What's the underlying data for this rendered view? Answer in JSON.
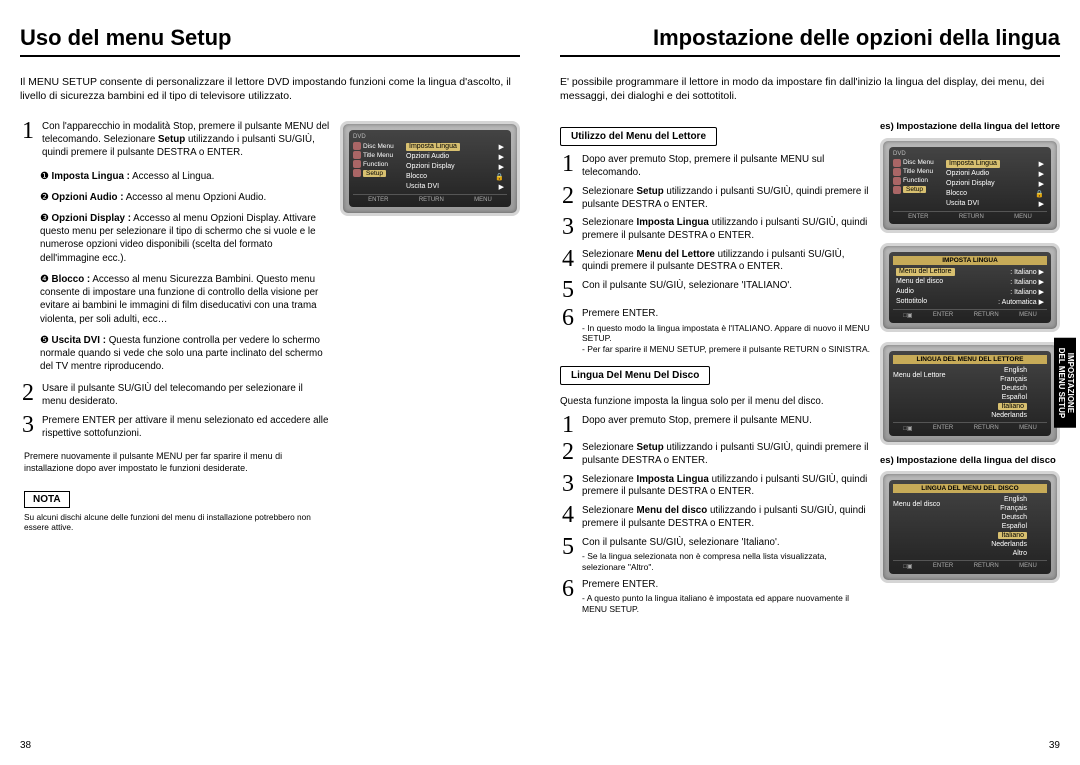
{
  "left": {
    "title": "Uso del menu Setup",
    "intro": "Il MENU SETUP consente di personalizzare il lettore DVD impostando funzioni come la lingua d'ascolto, il livello di sicurezza bambini ed il tipo di televisore utilizzato.",
    "steps": [
      {
        "n": "1",
        "body": "Con l'apparecchio in modalità Stop, premere il pulsante MENU del telecomando. Selezionare <b>Setup</b> utilizzando i pulsanti SU/GIÙ, quindi premere il pulsante DESTRA o ENTER."
      },
      {
        "n": "2",
        "body": "Usare il pulsante SU/GIÙ del telecomando per selezionare il menu desiderato."
      },
      {
        "n": "3",
        "body": "Premere ENTER per attivare il menu selezionato ed accedere alle rispettive sottofunzioni."
      }
    ],
    "bullets": [
      "❶ <b>Imposta Lingua :</b> Accesso al Lingua.",
      "❷ <b>Opzioni Audio :</b> Accesso al menu Opzioni Audio.",
      "❸ <b>Opzioni Display :</b> Accesso al menu Opzioni Display.  Attivare questo menu per selezionare il tipo di schermo che si vuole  e le numerose opzioni video disponibili (scelta del formato dell'immagine ecc.).",
      "❹ <b>Blocco :</b> Accesso al menu Sicurezza Bambini. Questo menu consente di impostare una funzione di controllo della visione per evitare ai bambini le immagini di film diseducativi con una trama violenta, per soli adulti, ecc…",
      "❺ <b>Uscita DVI :</b> Questa funzione controlla per vedere lo schermo normale quando si vede che solo una parte inclinato del schermo del TV mentre riproducendo."
    ],
    "finerule": "Premere nuovamente il pulsante MENU per far sparire il menu di installazione dopo aver impostato le funzioni desiderate.",
    "nota_label": "NOTA",
    "nota_text": "Su alcuni dischi alcune delle funzioni del menu di installazione potrebbero non essere attive.",
    "pagenum": "38",
    "osd1": {
      "dvd": "DVD",
      "menus": [
        "Disc Menu",
        "Title Menu",
        "Function",
        "Setup"
      ],
      "items": [
        {
          "label": "Imposta Lingua",
          "hl": true
        },
        {
          "label": "Opzioni Audio"
        },
        {
          "label": "Opzioni Display"
        },
        {
          "label": "Blocco",
          "icon": "lock"
        },
        {
          "label": "Uscita DVI"
        }
      ],
      "bottom": [
        "ENTER",
        "RETURN",
        "MENU"
      ]
    }
  },
  "right": {
    "title": "Impostazione delle opzioni della lingua",
    "intro": "E' possibile programmare il lettore in modo da impostare fin dall'inizio la lingua del display, dei menu, dei messaggi, dei dialoghi e dei sottotitoli.",
    "sectionA_title": "Utilizzo del Menu del Lettore",
    "sectionA_steps": [
      {
        "n": "1",
        "body": "Dopo aver premuto Stop, premere il pulsante MENU sul telecomando."
      },
      {
        "n": "2",
        "body": "Selezionare <b>Setup</b> utilizzando i pulsanti SU/GIÙ, quindi premere il pulsante DESTRA o ENTER."
      },
      {
        "n": "3",
        "body": "Selezionare <b>Imposta Lingua</b> utilizzando i pulsanti SU/GIÙ, quindi premere il pulsante DESTRA o ENTER."
      },
      {
        "n": "4",
        "body": "Selezionare <b>Menu del Lettore</b> utilizzando i pulsanti SU/GIÙ, quindi premere il pulsante DESTRA o ENTER."
      },
      {
        "n": "5",
        "body": "Con il pulsante SU/GIÙ, selezionare 'ITALIANO'."
      },
      {
        "n": "6",
        "body": "Premere ENTER.",
        "sub": "- In questo modo la lingua impostata è l'ITALIANO. Appare di nuovo il MENU SETUP.\n- Per far sparire il MENU SETUP, premere il pulsante RETURN o SINISTRA."
      }
    ],
    "sectionB_title": "Lingua Del Menu Del Disco",
    "sectionB_intro": "Questa funzione imposta la lingua solo per il menu del disco.",
    "sectionB_steps": [
      {
        "n": "1",
        "body": "Dopo aver premuto Stop, premere il pulsante MENU."
      },
      {
        "n": "2",
        "body": "Selezionare <b>Setup</b> utilizzando i pulsanti SU/GIÙ, quindi premere il pulsante DESTRA o ENTER."
      },
      {
        "n": "3",
        "body": "Selezionare <b>Imposta Lingua</b> utilizzando i pulsanti SU/GIÙ, quindi premere il pulsante DESTRA o ENTER."
      },
      {
        "n": "4",
        "body": "Selezionare <b>Menu del disco</b> utilizzando i pulsanti SU/GIÙ, quindi premere il pulsante DESTRA o ENTER."
      },
      {
        "n": "5",
        "body": "Con il pulsante SU/GIÙ, selezionare 'Italiano'.",
        "sub": "- Se la lingua selezionata non è compresa nella lista visualizzata, selezionare \"Altro\"."
      },
      {
        "n": "6",
        "body": "Premere ENTER.",
        "sub": "- A questo punto la lingua italiano è impostata ed appare nuovamente il MENU SETUP."
      }
    ],
    "sidecapA": "es) Impostazione della lingua del lettore",
    "sidecapB": "es) Impostazione della lingua del disco",
    "pagenum": "39",
    "sidetab": "IMPOSTAZIONE\nDEL MENU SETUP",
    "osd2": {
      "title": "IMPOSTA LINGUA",
      "rows": [
        {
          "l": "Menu del Lettore",
          "r": ": Italiano",
          "hl": true
        },
        {
          "l": "Menu del disco",
          "r": ": Italiano"
        },
        {
          "l": "Audio",
          "r": ": Italiano"
        },
        {
          "l": "Sottotitolo",
          "r": ": Automatica"
        }
      ]
    },
    "osd3": {
      "title": "LINGUA DEL MENU DEL LETTORE",
      "left_label": "Menu del Lettore",
      "langs": [
        "English",
        "Français",
        "Deutsch",
        "Español",
        "Italiano",
        "Nederlands"
      ],
      "hl": "Italiano"
    },
    "osd4": {
      "title": "LINGUA DEL MENU DEL DISCO",
      "left_label": "Menu del disco",
      "langs": [
        "English",
        "Français",
        "Deutsch",
        "Español",
        "Italiano",
        "Nederlands",
        "Altro"
      ],
      "hl": "Italiano"
    }
  }
}
